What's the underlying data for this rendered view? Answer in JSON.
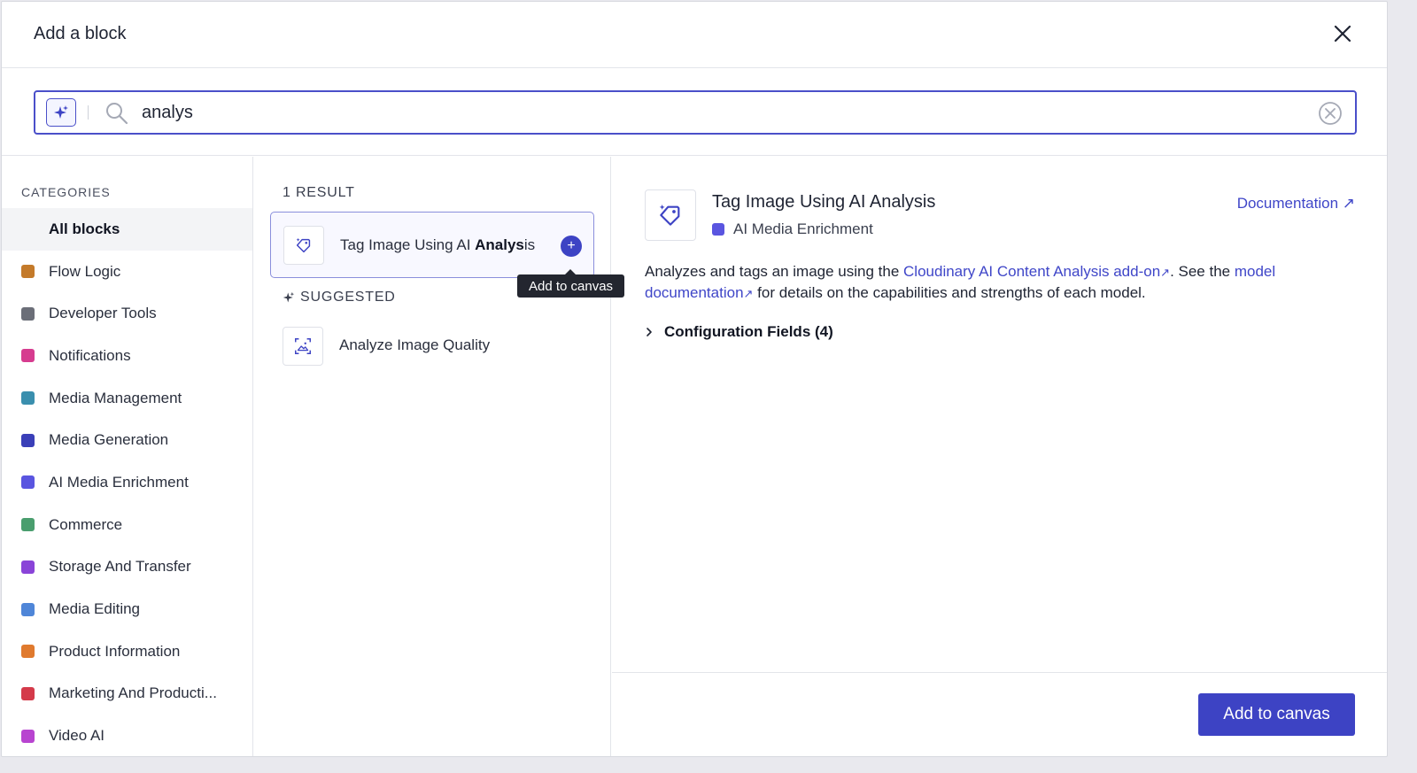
{
  "dialog": {
    "title": "Add a block"
  },
  "search": {
    "value": "analys",
    "placeholder": ""
  },
  "categories": {
    "heading": "CATEGORIES",
    "items": [
      {
        "label": "All blocks",
        "color": "",
        "active": true
      },
      {
        "label": "Flow Logic",
        "color": "#c47a2a"
      },
      {
        "label": "Developer Tools",
        "color": "#6b6e78"
      },
      {
        "label": "Notifications",
        "color": "#d63c8f"
      },
      {
        "label": "Media Management",
        "color": "#3a8fae"
      },
      {
        "label": "Media Generation",
        "color": "#3a3fb8"
      },
      {
        "label": "AI Media Enrichment",
        "color": "#5a55e0"
      },
      {
        "label": "Commerce",
        "color": "#4a9e6e"
      },
      {
        "label": "Storage And Transfer",
        "color": "#8a44d8"
      },
      {
        "label": "Media Editing",
        "color": "#4f86d8"
      },
      {
        "label": "Product Information",
        "color": "#e07a2e"
      },
      {
        "label": "Marketing And Producti...",
        "color": "#d43a4a"
      },
      {
        "label": "Video AI",
        "color": "#b844d0"
      }
    ]
  },
  "results": {
    "count_label": "1 RESULT",
    "items": [
      {
        "name_prefix": "Tag Image Using AI ",
        "name_match": "Analys",
        "name_suffix": "is",
        "icon": "tag-sparkle-icon"
      }
    ],
    "tooltip": "Add to canvas",
    "suggested_heading": "SUGGESTED",
    "suggested": [
      {
        "name": "Analyze Image Quality",
        "icon": "image-frame-icon"
      }
    ]
  },
  "details": {
    "title": "Tag Image Using AI Analysis",
    "category": "AI Media Enrichment",
    "category_color": "#5a55e0",
    "doc_link": "Documentation ↗",
    "desc_1": "Analyzes and tags an image using the ",
    "desc_link_1": "Cloudinary AI Content Analysis add-on",
    "desc_2": ". See the ",
    "desc_link_2": "model documentation",
    "desc_3": " for details on the capabilities and strengths of each model.",
    "config_label": "Configuration Fields (4)",
    "add_button": "Add to canvas"
  },
  "colors": {
    "accent": "#3d43c4",
    "link": "#3f46c8"
  }
}
